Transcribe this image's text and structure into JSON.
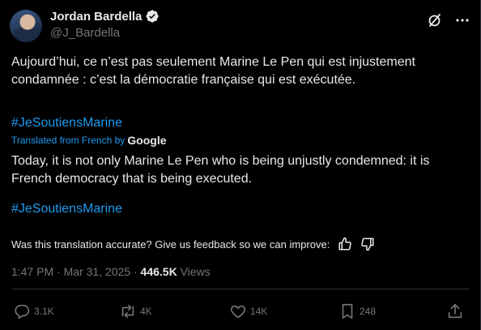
{
  "author": {
    "name": "Jordan Bardella",
    "handle": "@J_Bardella"
  },
  "tweet": {
    "original_text": "Aujourd’hui, ce n’est pas seulement Marine Le Pen qui est injustement condamnée : c’est la démocratie française qui est exécutée.",
    "hashtag": "#JeSoutiensMarine",
    "translated_from": "Translated from French by",
    "translator": "Google",
    "translated_text": "Today, it is not only Marine Le Pen who is being unjustly condemned: it is French democracy that is being executed.",
    "translated_hashtag": "#JeSoutiensMarine"
  },
  "feedback": {
    "prompt": "Was this translation accurate? Give us feedback so we can improve:"
  },
  "meta": {
    "time": "1:47 PM",
    "sep1": "·",
    "date": "Mar 31, 2025",
    "sep2": "·",
    "views_count": "446.5K",
    "views_label": "Views"
  },
  "actions": {
    "replies": "3.1K",
    "reposts": "4K",
    "likes": "14K",
    "bookmarks": "248"
  },
  "colors": {
    "accent": "#1d9bf0",
    "muted": "#71767b",
    "text": "#e7e9ea",
    "background": "#000000"
  },
  "icons": [
    "verified-badge-icon",
    "grok-icon",
    "more-icon",
    "thumbs-up-icon",
    "thumbs-down-icon",
    "reply-icon",
    "repost-icon",
    "like-icon",
    "bookmark-icon",
    "share-icon"
  ]
}
